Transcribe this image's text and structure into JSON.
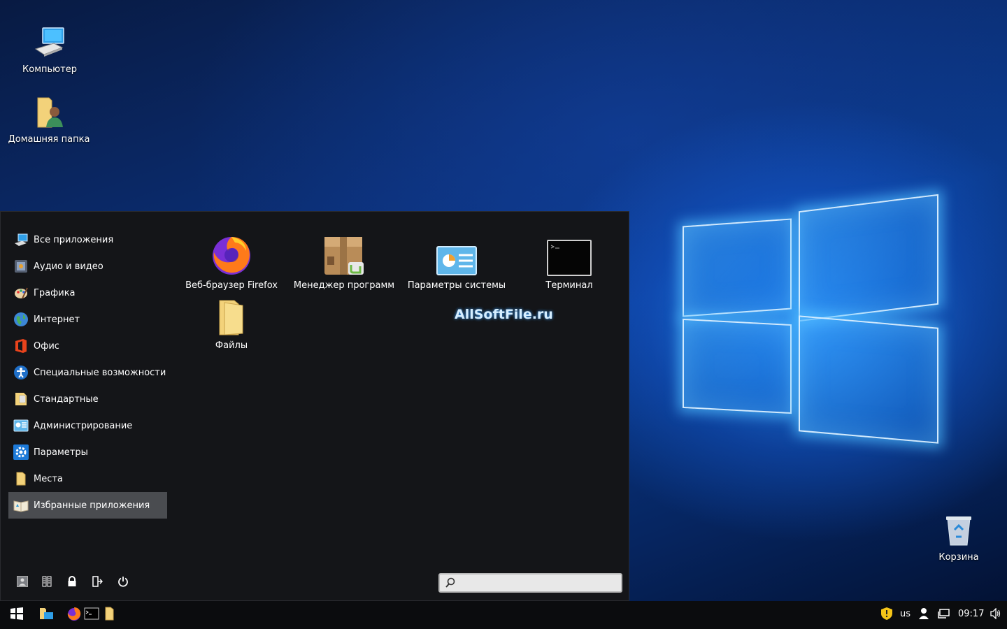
{
  "desktop": {
    "icons": [
      {
        "label": "Компьютер",
        "icon": "computer-icon"
      },
      {
        "label": "Домашняя папка",
        "icon": "home-folder-icon"
      },
      {
        "label": "Корзина",
        "icon": "trash-icon"
      }
    ]
  },
  "menu": {
    "categories": [
      {
        "label": "Все приложения",
        "icon": "all-apps-icon"
      },
      {
        "label": "Аудио и видео",
        "icon": "multimedia-icon"
      },
      {
        "label": "Графика",
        "icon": "graphics-icon"
      },
      {
        "label": "Интернет",
        "icon": "internet-icon"
      },
      {
        "label": "Офис",
        "icon": "office-icon"
      },
      {
        "label": "Специальные возможности",
        "icon": "accessibility-icon"
      },
      {
        "label": "Стандартные",
        "icon": "accessories-icon"
      },
      {
        "label": "Администрирование",
        "icon": "administration-icon"
      },
      {
        "label": "Параметры",
        "icon": "settings-gear-icon"
      },
      {
        "label": "Места",
        "icon": "places-folder-icon"
      },
      {
        "label": "Избранные приложения",
        "icon": "favorites-icon",
        "selected": true
      }
    ],
    "apps": [
      {
        "label": "Веб-браузер Firefox",
        "icon": "firefox-icon"
      },
      {
        "label": "Менеджер программ",
        "icon": "software-manager-icon"
      },
      {
        "label": "Параметры системы",
        "icon": "system-settings-icon"
      },
      {
        "label": "Терминал",
        "icon": "terminal-icon"
      },
      {
        "label": "Файлы",
        "icon": "files-folder-icon"
      }
    ],
    "watermark": "AllSoftFile.ru",
    "bottom_buttons": [
      "user-icon",
      "session-icon",
      "lock-icon",
      "logout-icon",
      "power-icon"
    ],
    "search": {
      "value": "",
      "placeholder": ""
    }
  },
  "taskbar": {
    "items": [
      "start-icon",
      "file-manager-icon",
      "firefox-icon",
      "terminal-icon",
      "folder-icon"
    ],
    "tray": {
      "keyboard_layout": "us",
      "time": "09:17",
      "icons": [
        "update-shield-icon",
        "user-icon",
        "network-icon",
        "volume-icon"
      ]
    }
  },
  "colors": {
    "menu_bg": "#141518",
    "selected_bg": "#4a4c50",
    "taskbar_bg": "#0b0c0e",
    "accent": "#1e90ff"
  }
}
